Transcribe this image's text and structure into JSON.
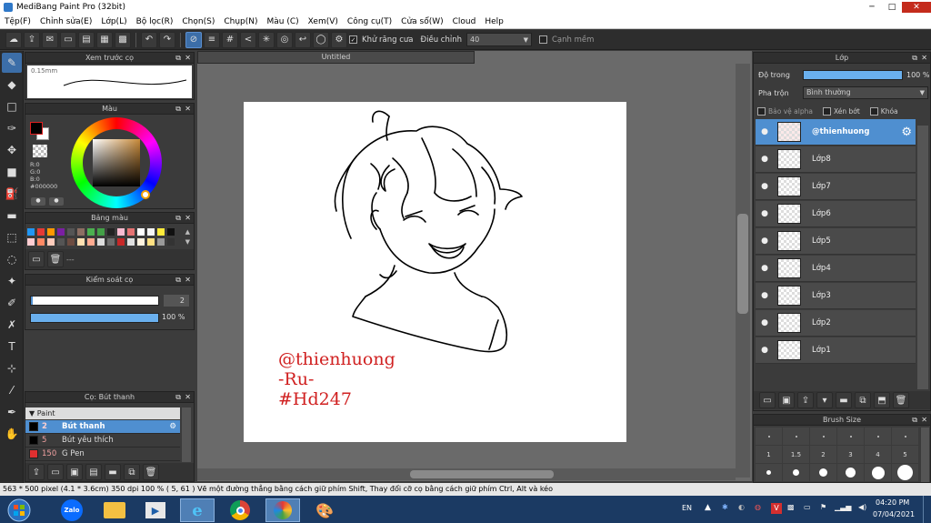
{
  "app": {
    "title": "MediBang Paint Pro (32bit)"
  },
  "menu": [
    "Tệp(F)",
    "Chỉnh sửa(E)",
    "Lớp(L)",
    "Bộ lọc(R)",
    "Chọn(S)",
    "Chụp(N)",
    "Màu (C)",
    "Xem(V)",
    "Công cụ(T)",
    "Cửa sổ(W)",
    "Cloud",
    "Help"
  ],
  "toolbar": {
    "antialias_label": "Khử răng cưa",
    "adjust_label": "Điều chỉnh",
    "adjust_value": "40",
    "edge_label": "Cạnh mềm"
  },
  "panels": {
    "brush_preview": {
      "title": "Xem trước cọ",
      "size_label": "0.15mm"
    },
    "color": {
      "title": "Màu",
      "r": "R:0",
      "g": "G:0",
      "b": "B:0",
      "hex": "#000000"
    },
    "palette": {
      "title": "Bảng màu",
      "footer": "---"
    },
    "brush_control": {
      "title": "Kiểm soát cọ",
      "size_value": "2",
      "opacity_value": "100 %"
    },
    "brush_list": {
      "title": "Cọ: Bút thanh",
      "group": "Paint",
      "items": [
        {
          "size": "2",
          "name": "Bút thanh",
          "color": "#000000",
          "selected": true
        },
        {
          "size": "5",
          "name": "Bút yêu thích",
          "color": "#000000",
          "selected": false
        },
        {
          "size": "150",
          "name": "G Pen",
          "color": "#e03030",
          "selected": false
        }
      ]
    },
    "layer": {
      "title": "Lớp",
      "opacity_label": "Độ trong",
      "opacity_value": "100 %",
      "opacity_fraction": 1.0,
      "blend_label": "Pha trộn",
      "blend_value": "Bình thường",
      "protect_alpha": "Bảo vệ alpha",
      "clipping": "Xén bớt",
      "lock": "Khóa",
      "layers": [
        "@thienhuong",
        "Lớp8",
        "Lớp7",
        "Lớp6",
        "Lớp5",
        "Lớp4",
        "Lớp3",
        "Lớp2",
        "Lớp1"
      ]
    },
    "brush_size": {
      "title": "Brush Size",
      "sizes": [
        "1",
        "1.5",
        "2",
        "3",
        "4",
        "5"
      ]
    }
  },
  "document": {
    "tab": "Untitled",
    "text_lines": [
      "@thienhuong",
      "-Ru-",
      "#Hd247"
    ],
    "text_color": "#d02020"
  },
  "status": "563 * 500 pixel  (4.1 * 3.6cm)  350 dpi  100 %  ( 5, 61 )  Vẽ một đường thẳng bằng cách giữ phím Shift, Thay đổi cỡ cọ bằng cách giữ phím Ctrl, Alt và kéo",
  "taskbar": {
    "lang": "EN",
    "time": "04:20 PM",
    "date": "07/04/2021",
    "apps": [
      "start",
      "zalo",
      "explorer",
      "media-player",
      "internet-explorer",
      "chrome",
      "medibang",
      "paint"
    ]
  },
  "colors": {
    "accent": "#4f8fd0",
    "panel_bg": "#3b3b3b",
    "canvas_bg": "#6a6a6a"
  }
}
